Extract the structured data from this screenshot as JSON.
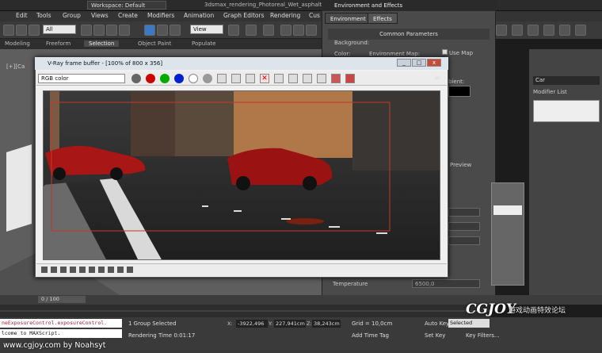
{
  "titlebar": {
    "workspace": "Workspace: Default",
    "filename": "3dsmax_rendering_Photoreal_Wet_asphalt_..."
  },
  "menu": [
    "Edit",
    "Tools",
    "Group",
    "Views",
    "Create",
    "Modifiers",
    "Animation",
    "Graph Editors",
    "Rendering",
    "Cus"
  ],
  "toolbar": {
    "filter": "All",
    "ref_coord": "View"
  },
  "ribbon": {
    "tabs": [
      "Modeling",
      "Freeform",
      "Selection",
      "Object Paint",
      "Populate"
    ],
    "active": "Selection"
  },
  "viewport": {
    "label": "[+][Ca"
  },
  "environment_dialog": {
    "title": "Environment and Effects",
    "tabs": [
      "Environment",
      "Effects"
    ],
    "section": "Common Parameters",
    "background_label": "Background:",
    "color_label": "Color:",
    "env_map_label": "Environment Map:",
    "use_map_label": "Use Map",
    "ambient_label": "bient:",
    "preview_label": "Preview",
    "temperature_label": "Temperature",
    "temperature_value": "6500,0"
  },
  "command_panel": {
    "object_name": "Car",
    "modifier_list": "Modifier List"
  },
  "vfb": {
    "title": "V-Ray frame buffer - [100% of 800 x 356]",
    "channel": "RGB color",
    "window_buttons": [
      "_",
      "□",
      "x"
    ]
  },
  "timeline": {
    "frame": "0 / 100"
  },
  "status": {
    "listener_line1": "neExposureControl.exposureControl.",
    "listener_line2": "lcome to MAXScript.",
    "selection": "1 Group Selected",
    "render_time": "Rendering Time 0:01:17",
    "x_label": "X:",
    "x": "-3922,496",
    "y_label": "Y:",
    "y": "227,941cm",
    "z_label": "Z:",
    "z": "38,243cm",
    "grid": "Grid = 10,0cm",
    "add_time_tag": "Add Time Tag",
    "auto_key": "Auto Key",
    "set_key": "Set Key",
    "selected": "Selected",
    "key_filters": "Key Filters..."
  },
  "watermark": {
    "credit": "www.cgjoy.com by Noahsyt",
    "logo": "CGJOY",
    "logo_cn": "游戏动画特效论坛"
  },
  "icons": [
    "undo-icon",
    "redo-icon",
    "select-icon",
    "move-icon",
    "rotate-icon",
    "scale-icon",
    "render-icon",
    "teapot-icon"
  ]
}
